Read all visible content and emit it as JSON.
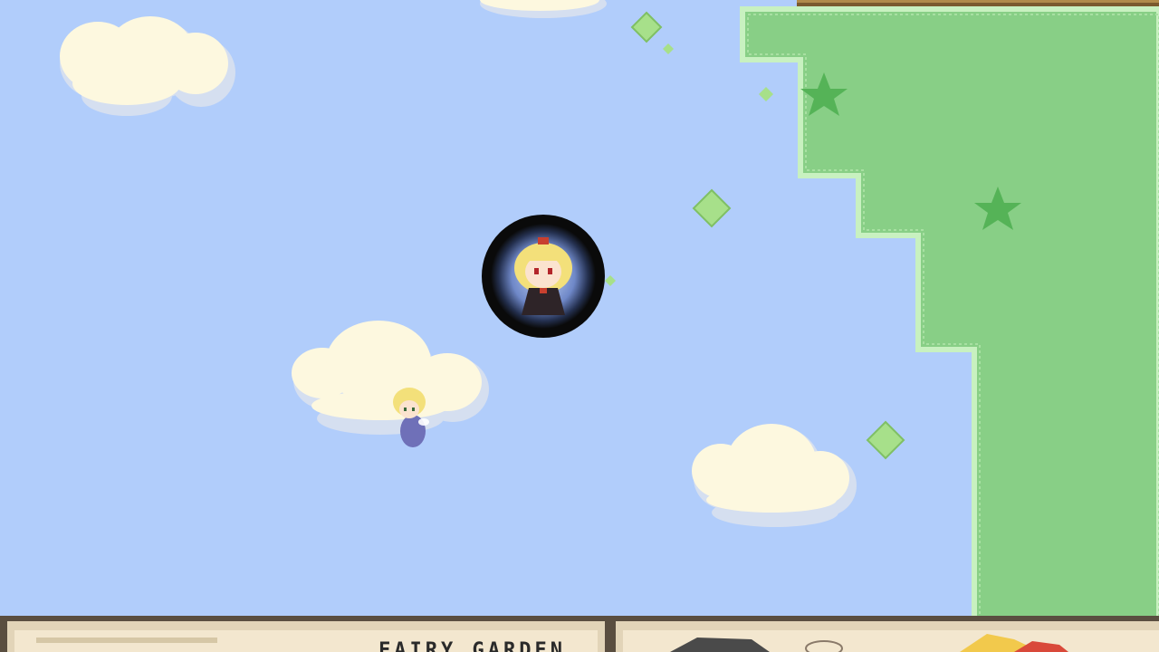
{
  "game": {
    "hud": {
      "area_label": "FAIRY GARDEN"
    },
    "colors": {
      "sky": "#b1cdfb",
      "cloud": "#fdf8df",
      "cloud_shadow": "#d5dff0",
      "grass": "#88cf86",
      "grass_edge": "#c8f1c0",
      "grass_stars": "#55b357",
      "gem": "#a7e08a",
      "hud_frame": "#5a4e40",
      "hud_panel": "#f3e7cf",
      "fence": "#7a5a2e",
      "player_ring": "#111111",
      "player_inner": "#6f88c8"
    },
    "icons": {
      "player": "character-portrait-ring",
      "fairy": "fairy-sprite",
      "gem": "diamond-gem",
      "star": "grass-star"
    }
  }
}
